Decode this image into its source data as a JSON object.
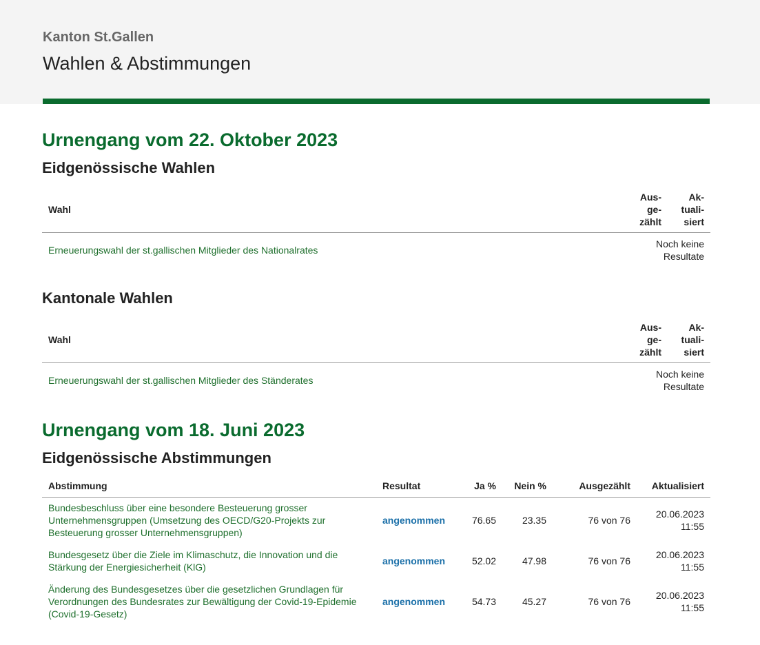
{
  "header": {
    "org": "Kanton St.Gallen",
    "app_title": "Wahlen & Abstimmungen"
  },
  "colors": {
    "brand_green": "#0a6b2e",
    "link_green": "#1e6f2c",
    "result_blue": "#1a6fa8"
  },
  "oct": {
    "title": "Urnengang vom 22. Oktober 2023",
    "federal": {
      "title": "Eidgenössische Wahlen",
      "col_wahl": "Wahl",
      "col_ausgezaehlt": "Aus-\nge-\nzählt",
      "col_aktualisiert": "Ak-\ntuali-\nsiert",
      "row_name": "Erneuerungswahl der st.gallischen Mitglieder des Nationalrates",
      "row_status": "Noch keine Resultate"
    },
    "cantonal": {
      "title": "Kantonale Wahlen",
      "col_wahl": "Wahl",
      "col_ausgezaehlt": "Aus-\nge-\nzählt",
      "col_aktualisiert": "Ak-\ntuali-\nsiert",
      "row_name": "Erneuerungswahl der st.gallischen Mitglieder des Ständerates",
      "row_status": "Noch keine Resultate"
    }
  },
  "jun": {
    "title": "Urnengang vom 18. Juni 2023",
    "federal_votes": {
      "title": "Eidgenössische Abstimmungen",
      "cols": {
        "abstimmung": "Abstimmung",
        "resultat": "Resultat",
        "ja": "Ja %",
        "nein": "Nein %",
        "ausgezaehlt": "Ausgezählt",
        "aktualisiert": "Aktualisiert"
      },
      "rows": [
        {
          "name": "Bundesbeschluss über eine besondere Besteuerung grosser Unternehmensgruppen (Umsetzung des OECD/G20-Projekts zur Besteuerung grosser Unternehmensgruppen)",
          "result": "angenommen",
          "ja": "76.65",
          "nein": "23.35",
          "counted": "76 von 76",
          "date": "20.06.2023",
          "time": "11:55"
        },
        {
          "name": "Bundesgesetz über die Ziele im Klimaschutz, die Innovation und die Stärkung der Energiesicherheit (KlG)",
          "result": "angenommen",
          "ja": "52.02",
          "nein": "47.98",
          "counted": "76 von 76",
          "date": "20.06.2023",
          "time": "11:55"
        },
        {
          "name": "Änderung des Bundesgesetzes über die gesetzlichen Grundlagen für Verordnungen des Bundesrates zur Bewältigung der Covid-19-Epidemie (Covid-19-Gesetz)",
          "result": "angenommen",
          "ja": "54.73",
          "nein": "45.27",
          "counted": "76 von 76",
          "date": "20.06.2023",
          "time": "11:55"
        }
      ]
    }
  }
}
